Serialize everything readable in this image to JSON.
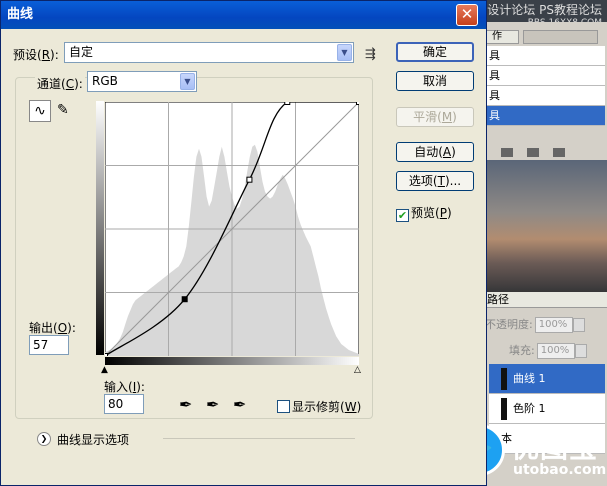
{
  "background": {
    "watermark_line1": "思缘设计论坛",
    "watermark_line1b": "PS教程论坛",
    "watermark_line2": "BBS.16XX8.COM",
    "panel_tab": "作",
    "list_rows": [
      "具",
      "具",
      "具",
      "具"
    ],
    "layers_tab": "路径",
    "opacity_label": "不透明度:",
    "opacity_value": "100%",
    "fill_label": "填充:",
    "fill_value": "100%",
    "layers": [
      {
        "label": "曲线 1",
        "selected": true
      },
      {
        "label": "色阶 1",
        "selected": false
      },
      {
        "label": "本",
        "selected": false
      }
    ],
    "logo_text": "优图宝",
    "logo_domain": "utobao.com"
  },
  "dialog": {
    "title": "曲线",
    "preset_label": "预设(",
    "preset_key": "R",
    "preset_value": "自定",
    "channel_label": "通道(",
    "channel_key": "C",
    "channel_value": "RGB",
    "buttons": {
      "ok": "确定",
      "cancel": "取消",
      "smooth": "平滑(",
      "smooth_key": "M",
      "auto": "自动(",
      "auto_key": "A",
      "options": "选项(",
      "options_key": "T",
      "options_suffix": ")..."
    },
    "preview_label": "预览(",
    "preview_key": "P",
    "preview_checked": true,
    "output_label": "输出(",
    "output_key": "O",
    "output_value": "57",
    "input_label": "输入(",
    "input_key": "I",
    "input_value": "80",
    "clipping_label": "显示修剪(",
    "clipping_key": "W",
    "clipping_checked": false,
    "curve_options_label": "曲线显示选项"
  },
  "curve": {
    "points": [
      [
        0,
        0
      ],
      [
        80,
        57
      ],
      [
        145,
        177
      ],
      [
        183,
        255
      ],
      [
        255,
        255
      ]
    ],
    "selected_point": [
      80,
      57
    ],
    "histogram": [
      4,
      5,
      6,
      8,
      10,
      14,
      18,
      24,
      32,
      40,
      46,
      52,
      56,
      58,
      60,
      62,
      64,
      66,
      68,
      70,
      72,
      74,
      76,
      78,
      80,
      82,
      84,
      86,
      88,
      90,
      94,
      100,
      110,
      130,
      155,
      180,
      200,
      208,
      200,
      180,
      160,
      150,
      156,
      170,
      185,
      200,
      210,
      200,
      185,
      170,
      160,
      152,
      148,
      150,
      158,
      170,
      185,
      200,
      210,
      212,
      205,
      190,
      175,
      165,
      160,
      158,
      160,
      165,
      172,
      178,
      182,
      178,
      172,
      165,
      158,
      150,
      140,
      132,
      126,
      120,
      115,
      110,
      100,
      90,
      80,
      68,
      58,
      48,
      40,
      32,
      26,
      20,
      16,
      12,
      10,
      8,
      6,
      5,
      4,
      3,
      2
    ]
  }
}
